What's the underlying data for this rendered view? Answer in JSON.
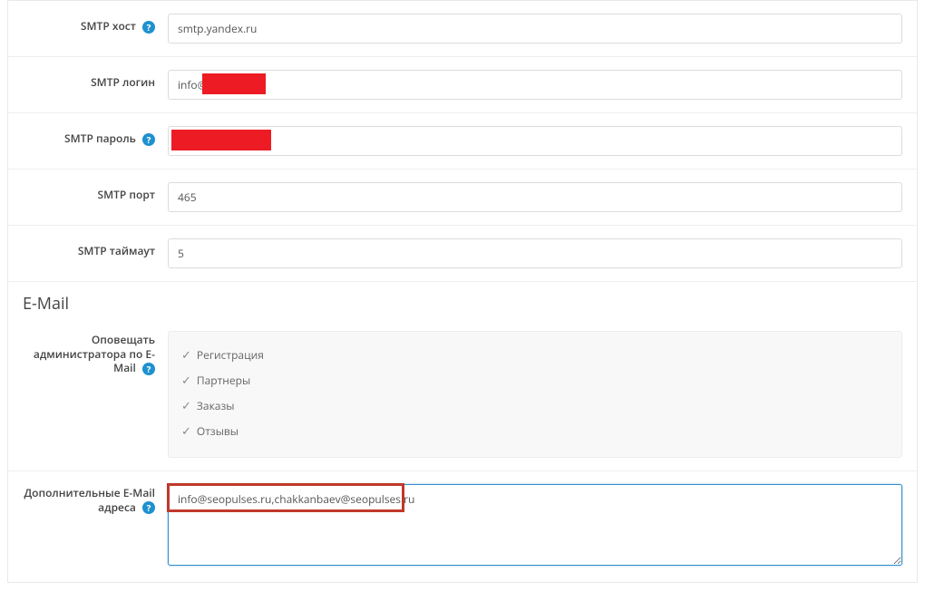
{
  "smtp": {
    "host_label": "SMTP хост",
    "host_value": "smtp.yandex.ru",
    "login_label": "SMTP логин",
    "login_value": "info@                .ru",
    "password_label": "SMTP пароль",
    "password_value": "",
    "port_label": "SMTP порт",
    "port_value": "465",
    "timeout_label": "SMTP таймаут",
    "timeout_value": "5"
  },
  "email_section_title": "E-Mail",
  "alerts": {
    "label": "Оповещать администратора по E-Mail",
    "items": [
      "Регистрация",
      "Партнеры",
      "Заказы",
      "Отзывы"
    ]
  },
  "extra": {
    "label": "Дополнительные E-Mail адреса",
    "value": "info@seopulses.ru,chakkanbaev@seopulses.ru"
  },
  "help_glyph": "?"
}
